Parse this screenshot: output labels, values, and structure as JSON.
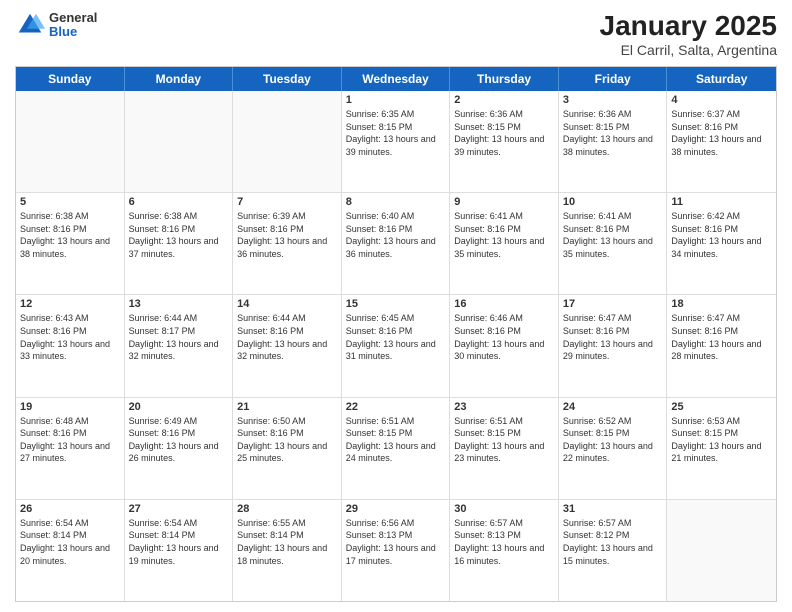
{
  "header": {
    "logo": {
      "general": "General",
      "blue": "Blue"
    },
    "title": "January 2025",
    "subtitle": "El Carril, Salta, Argentina"
  },
  "calendar": {
    "days_of_week": [
      "Sunday",
      "Monday",
      "Tuesday",
      "Wednesday",
      "Thursday",
      "Friday",
      "Saturday"
    ],
    "weeks": [
      [
        {
          "day": "",
          "info": ""
        },
        {
          "day": "",
          "info": ""
        },
        {
          "day": "",
          "info": ""
        },
        {
          "day": "1",
          "info": "Sunrise: 6:35 AM\nSunset: 8:15 PM\nDaylight: 13 hours and 39 minutes."
        },
        {
          "day": "2",
          "info": "Sunrise: 6:36 AM\nSunset: 8:15 PM\nDaylight: 13 hours and 39 minutes."
        },
        {
          "day": "3",
          "info": "Sunrise: 6:36 AM\nSunset: 8:15 PM\nDaylight: 13 hours and 38 minutes."
        },
        {
          "day": "4",
          "info": "Sunrise: 6:37 AM\nSunset: 8:16 PM\nDaylight: 13 hours and 38 minutes."
        }
      ],
      [
        {
          "day": "5",
          "info": "Sunrise: 6:38 AM\nSunset: 8:16 PM\nDaylight: 13 hours and 38 minutes."
        },
        {
          "day": "6",
          "info": "Sunrise: 6:38 AM\nSunset: 8:16 PM\nDaylight: 13 hours and 37 minutes."
        },
        {
          "day": "7",
          "info": "Sunrise: 6:39 AM\nSunset: 8:16 PM\nDaylight: 13 hours and 36 minutes."
        },
        {
          "day": "8",
          "info": "Sunrise: 6:40 AM\nSunset: 8:16 PM\nDaylight: 13 hours and 36 minutes."
        },
        {
          "day": "9",
          "info": "Sunrise: 6:41 AM\nSunset: 8:16 PM\nDaylight: 13 hours and 35 minutes."
        },
        {
          "day": "10",
          "info": "Sunrise: 6:41 AM\nSunset: 8:16 PM\nDaylight: 13 hours and 35 minutes."
        },
        {
          "day": "11",
          "info": "Sunrise: 6:42 AM\nSunset: 8:16 PM\nDaylight: 13 hours and 34 minutes."
        }
      ],
      [
        {
          "day": "12",
          "info": "Sunrise: 6:43 AM\nSunset: 8:16 PM\nDaylight: 13 hours and 33 minutes."
        },
        {
          "day": "13",
          "info": "Sunrise: 6:44 AM\nSunset: 8:17 PM\nDaylight: 13 hours and 32 minutes."
        },
        {
          "day": "14",
          "info": "Sunrise: 6:44 AM\nSunset: 8:16 PM\nDaylight: 13 hours and 32 minutes."
        },
        {
          "day": "15",
          "info": "Sunrise: 6:45 AM\nSunset: 8:16 PM\nDaylight: 13 hours and 31 minutes."
        },
        {
          "day": "16",
          "info": "Sunrise: 6:46 AM\nSunset: 8:16 PM\nDaylight: 13 hours and 30 minutes."
        },
        {
          "day": "17",
          "info": "Sunrise: 6:47 AM\nSunset: 8:16 PM\nDaylight: 13 hours and 29 minutes."
        },
        {
          "day": "18",
          "info": "Sunrise: 6:47 AM\nSunset: 8:16 PM\nDaylight: 13 hours and 28 minutes."
        }
      ],
      [
        {
          "day": "19",
          "info": "Sunrise: 6:48 AM\nSunset: 8:16 PM\nDaylight: 13 hours and 27 minutes."
        },
        {
          "day": "20",
          "info": "Sunrise: 6:49 AM\nSunset: 8:16 PM\nDaylight: 13 hours and 26 minutes."
        },
        {
          "day": "21",
          "info": "Sunrise: 6:50 AM\nSunset: 8:16 PM\nDaylight: 13 hours and 25 minutes."
        },
        {
          "day": "22",
          "info": "Sunrise: 6:51 AM\nSunset: 8:15 PM\nDaylight: 13 hours and 24 minutes."
        },
        {
          "day": "23",
          "info": "Sunrise: 6:51 AM\nSunset: 8:15 PM\nDaylight: 13 hours and 23 minutes."
        },
        {
          "day": "24",
          "info": "Sunrise: 6:52 AM\nSunset: 8:15 PM\nDaylight: 13 hours and 22 minutes."
        },
        {
          "day": "25",
          "info": "Sunrise: 6:53 AM\nSunset: 8:15 PM\nDaylight: 13 hours and 21 minutes."
        }
      ],
      [
        {
          "day": "26",
          "info": "Sunrise: 6:54 AM\nSunset: 8:14 PM\nDaylight: 13 hours and 20 minutes."
        },
        {
          "day": "27",
          "info": "Sunrise: 6:54 AM\nSunset: 8:14 PM\nDaylight: 13 hours and 19 minutes."
        },
        {
          "day": "28",
          "info": "Sunrise: 6:55 AM\nSunset: 8:14 PM\nDaylight: 13 hours and 18 minutes."
        },
        {
          "day": "29",
          "info": "Sunrise: 6:56 AM\nSunset: 8:13 PM\nDaylight: 13 hours and 17 minutes."
        },
        {
          "day": "30",
          "info": "Sunrise: 6:57 AM\nSunset: 8:13 PM\nDaylight: 13 hours and 16 minutes."
        },
        {
          "day": "31",
          "info": "Sunrise: 6:57 AM\nSunset: 8:12 PM\nDaylight: 13 hours and 15 minutes."
        },
        {
          "day": "",
          "info": ""
        }
      ]
    ]
  }
}
